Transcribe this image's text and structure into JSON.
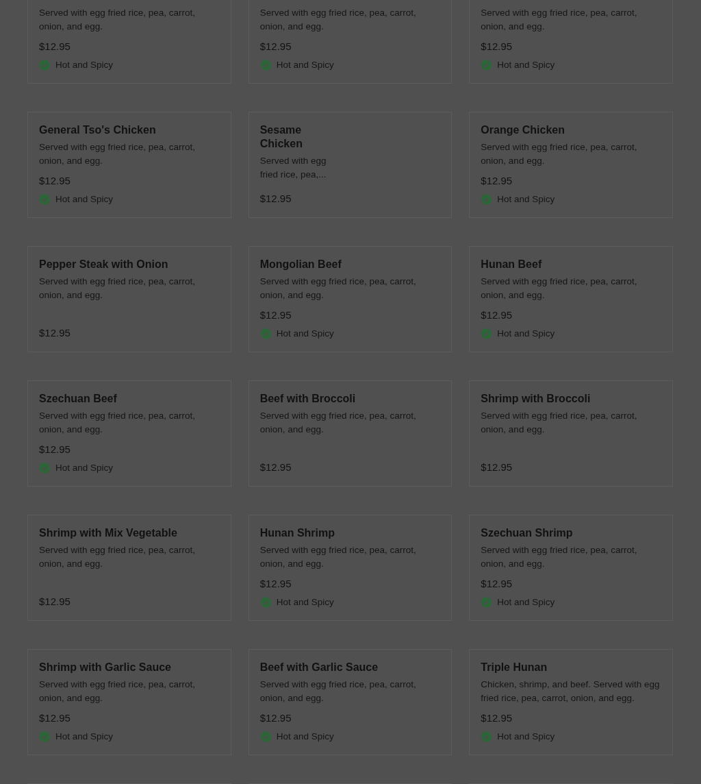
{
  "rows": [
    {
      "cut_top": true,
      "items": [
        {
          "description": "Served with egg fried rice, pea, carrot, onion, and egg.",
          "price": "$12.95",
          "tag": "Hot and Spicy",
          "compact": false
        },
        {
          "description": "Served with egg fried rice, pea, carrot, onion, and egg.",
          "price": "$12.95",
          "tag": "Hot and Spicy",
          "compact": false
        },
        {
          "description": "Served with egg fried rice, pea, carrot, onion, and egg.",
          "price": "$12.95",
          "tag": "Hot and Spicy",
          "compact": false
        }
      ]
    },
    {
      "cut_top": false,
      "items": [
        {
          "title": "General Tso's Chicken",
          "description": "Served with egg fried rice, pea, carrot, onion, and egg.",
          "price": "$12.95",
          "tag": "Hot and Spicy",
          "compact": false
        },
        {
          "title": "Sesame Chicken",
          "description": "Served with egg fried rice, pea,...",
          "price": "$12.95",
          "compact": true
        },
        {
          "title": "Orange Chicken",
          "description": "Served with egg fried rice, pea, carrot, onion, and egg.",
          "price": "$12.95",
          "tag": "Hot and Spicy",
          "compact": false
        }
      ]
    },
    {
      "cut_top": false,
      "items": [
        {
          "title": "Pepper Steak with Onion",
          "description": "Served with egg fried rice, pea, carrot, onion, and egg.",
          "price": "$12.95",
          "compact": false
        },
        {
          "title": "Mongolian Beef",
          "description": "Served with egg fried rice, pea, carrot, onion, and egg.",
          "price": "$12.95",
          "tag": "Hot and Spicy",
          "compact": false
        },
        {
          "title": "Hunan Beef",
          "description": "Served with egg fried rice, pea, carrot, onion, and egg.",
          "price": "$12.95",
          "tag": "Hot and Spicy",
          "compact": false
        }
      ]
    },
    {
      "cut_top": false,
      "items": [
        {
          "title": "Szechuan Beef",
          "description": "Served with egg fried rice, pea, carrot, onion, and egg.",
          "price": "$12.95",
          "tag": "Hot and Spicy",
          "compact": false
        },
        {
          "title": "Beef with Broccoli",
          "description": "Served with egg fried rice, pea, carrot, onion, and egg.",
          "price": "$12.95",
          "compact": false
        },
        {
          "title": "Shrimp with Broccoli",
          "description": "Served with egg fried rice, pea, carrot, onion, and egg.",
          "price": "$12.95",
          "compact": false
        }
      ]
    },
    {
      "cut_top": false,
      "items": [
        {
          "title": "Shrimp with Mix Vegetable",
          "description": "Served with egg fried rice, pea, carrot, onion, and egg.",
          "price": "$12.95",
          "compact": false
        },
        {
          "title": "Hunan Shrimp",
          "description": "Served with egg fried rice, pea, carrot, onion, and egg.",
          "price": "$12.95",
          "tag": "Hot and Spicy",
          "compact": false
        },
        {
          "title": "Szechuan Shrimp",
          "description": "Served with egg fried rice, pea, carrot, onion, and egg.",
          "price": "$12.95",
          "tag": "Hot and Spicy",
          "compact": false
        }
      ]
    },
    {
      "cut_top": false,
      "items": [
        {
          "title": "Shrimp with Garlic Sauce",
          "description": "Served with egg fried rice, pea, carrot, onion, and egg.",
          "price": "$12.95",
          "tag": "Hot and Spicy",
          "compact": false
        },
        {
          "title": "Beef with Garlic Sauce",
          "description": "Served with egg fried rice, pea, carrot, onion, and egg.",
          "price": "$12.95",
          "tag": "Hot and Spicy",
          "compact": false
        },
        {
          "title": "Triple Hunan",
          "description": "Chicken, shrimp, and beef. Served with egg fried rice, pea, carrot, onion, and egg.",
          "price": "$12.95",
          "tag": "Hot and Spicy",
          "compact": false
        }
      ]
    }
  ]
}
